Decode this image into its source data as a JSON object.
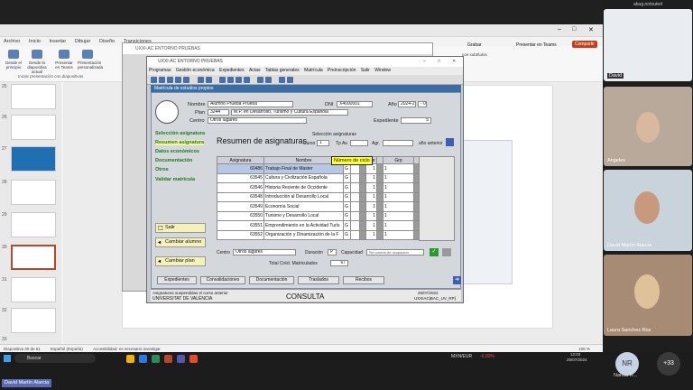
{
  "ppt": {
    "title": "",
    "tabs": [
      "Archivo",
      "Inicio",
      "Insertar",
      "Dibujar",
      "Diseño",
      "Transiciones"
    ],
    "ribbon_buttons": [
      "Desde el principio",
      "Desde la diapositiva actual",
      "Presentar en Teams",
      "Presentación personalizada"
    ],
    "ribbon_group": "Iniciar presentación con diapositivas",
    "right_buttons": {
      "record": "Grabar",
      "teams": "Presentar en Teams",
      "share": "Compartir"
    },
    "subtitle_opt": "con subtítulos",
    "slide_numbers": [
      "25",
      "26",
      "27",
      "28",
      "29",
      "30",
      "31",
      "32",
      "33"
    ],
    "status": {
      "slide": "Diapositiva 30 de 51",
      "lang": "Español (España)",
      "access": "Accesibilidad: es necesario investigar",
      "zoom": "106 %"
    }
  },
  "dialog": {
    "title": "UXXI-AC ENTORNO PRUEBAS"
  },
  "app": {
    "title": "UXXI-AC ENTORNO PRUEBAS",
    "menu": [
      "Programas",
      "Gestión económica",
      "Expedientes",
      "Actas",
      "Tablas generales",
      "Matrícula",
      "Preinscripción",
      "Salir",
      "Window"
    ],
    "form_title": "Matrícula de estudios propios",
    "nombre_label": "Nombre",
    "nombre": "Alumno Prueba Prueba",
    "dni_label": "DNI",
    "dni": "X4000001",
    "ano_label": "Año",
    "ano": "2024-25",
    "ano_suffix": "- 01",
    "plan_label": "Plan",
    "plan_code": "3244",
    "plan": "M.P. en Desarrollo, Turismo y Cultura Española",
    "centro_label": "Centro",
    "centro": "Otros lugares",
    "expediente_label": "Expediente",
    "expediente": "5",
    "nav": [
      "Selección asignatura",
      "Resumen asignatura",
      "Datos económicos",
      "Documentación",
      "Otros",
      "Validar matrícula"
    ],
    "side_buttons": [
      "Salir",
      "Cambiar alumno",
      "Cambiar plan"
    ],
    "heading": "Resumen de asignaturas",
    "seleccion": {
      "title": "Selección asignaturas",
      "curso": "Curso",
      "curso_val": "1",
      "tipo": "Tp As.",
      "agr": "Agr.",
      "ano_ant": "año anterior"
    },
    "columns": [
      "Asignatura",
      "Nombre",
      "Tc",
      "Cr",
      "Cur",
      "Grp"
    ],
    "rows": [
      {
        "code": "60486",
        "name": "Trabajo Final de Master",
        "tc": "G",
        "cur": "1",
        "grp": "1"
      },
      {
        "code": "63545",
        "name": "Cultura y Civilización Española",
        "tc": "G",
        "cur": "1",
        "grp": "1"
      },
      {
        "code": "63546",
        "name": "Historia Reciente de Occidente",
        "tc": "G",
        "cur": "1",
        "grp": "1"
      },
      {
        "code": "63548",
        "name": "Introducción al Desarrollo Local",
        "tc": "G",
        "cur": "1",
        "grp": "1"
      },
      {
        "code": "63549",
        "name": "Economía Social",
        "tc": "G",
        "cur": "1",
        "grp": "1"
      },
      {
        "code": "63550",
        "name": "Turismo y Desarrollo Local",
        "tc": "G",
        "cur": "1",
        "grp": "1"
      },
      {
        "code": "63551",
        "name": "Emprendimiento en la Actividad Turís",
        "tc": "G",
        "cur": "1",
        "grp": "1"
      },
      {
        "code": "63552",
        "name": "Organización y Dinamización de la F",
        "tc": "G",
        "cur": "1",
        "grp": "1"
      }
    ],
    "tooltip": "Número de ciclo",
    "bottom": {
      "centro_label": "Centro",
      "centro": "Otros lugares",
      "duracion": "Duración",
      "duracion_val": "P",
      "capacidad": "Capacidad",
      "cap_val": "Sin control de ocupación",
      "total_label": "Total Créd. Matriculados",
      "total": "67"
    },
    "buttons": [
      "Expedientes",
      "Convalidaciones",
      "Documentación",
      "Traslados",
      "Recibos"
    ],
    "footer": {
      "left1": "Asignaturas suspendidas el curso anterior",
      "left2": "UNIVERSITAT DE VALÈNCIA",
      "center": "CONSULTA",
      "date": "25/07/2024",
      "code": "UXXIAC|BAC_UV_RP]"
    }
  },
  "video": {
    "top_label": "abug.notouted",
    "participants": [
      {
        "name": "David"
      },
      {
        "name": "Angeles"
      },
      {
        "name": "David Martín Alarcia"
      },
      {
        "name": "Laura Sanchez Ros"
      },
      {
        "name": "Nanda R...",
        "initials": "NR"
      }
    ],
    "more": "+33"
  },
  "taskbar": {
    "search": "Buscar",
    "ticker": "MXN/EUR",
    "ticker_val": "-0,00%",
    "time": "12:03",
    "date": "25/07/2024",
    "badge": "David Martín Alarcia"
  }
}
